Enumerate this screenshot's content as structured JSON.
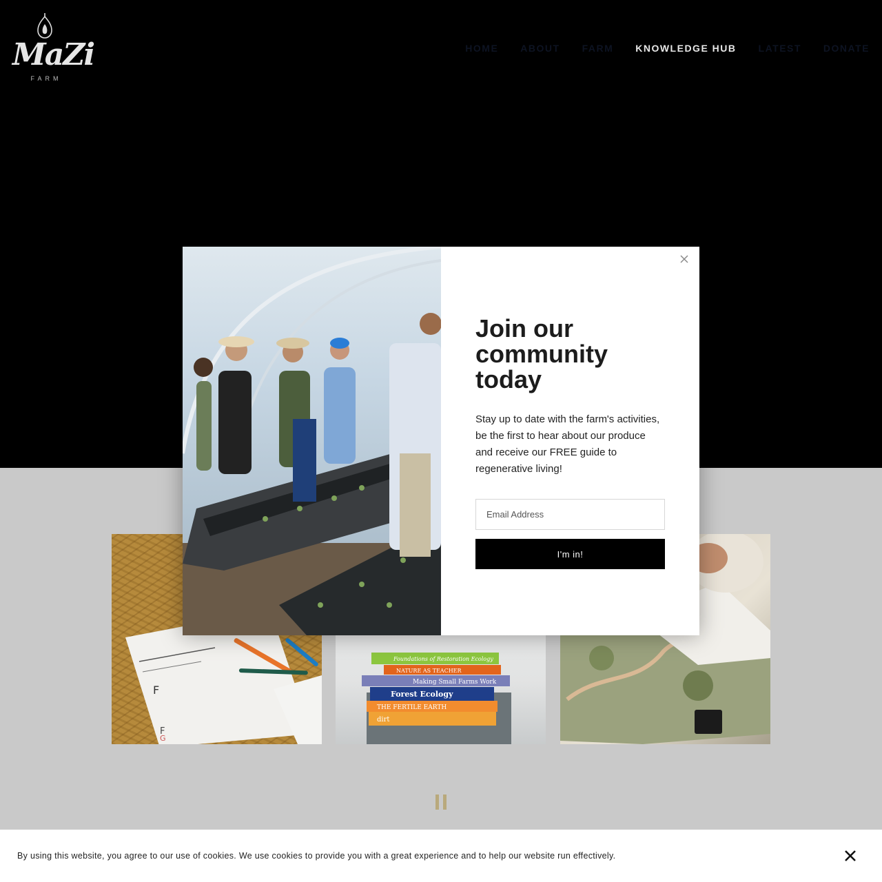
{
  "header": {
    "logo": {
      "word": "MaZi",
      "sub": "FARM",
      "icon": "fig-icon"
    },
    "nav": [
      {
        "label": "HOME",
        "active": false
      },
      {
        "label": "ABOUT",
        "active": false
      },
      {
        "label": "FARM",
        "active": false
      },
      {
        "label": "KNOWLEDGE HUB",
        "active": true
      },
      {
        "label": "LATEST",
        "active": false
      },
      {
        "label": "DONATE",
        "active": false
      }
    ]
  },
  "modal": {
    "close_icon": "close-icon",
    "title": "Join our community today",
    "text": "Stay up to date with the farm's activities, be the first to hear about our produce and receive our FREE guide to regenerative living!",
    "email_placeholder": "Email Address",
    "submit_label": "I'm in!"
  },
  "cards": [
    {
      "name": "planning-notes-photo"
    },
    {
      "name": "book-stack-photo",
      "books": [
        "Foundations of Restoration Ecology",
        "NATURE AS TEACHER",
        "Making Small Farms Work",
        "Forest Ecology",
        "THE FERTILE EARTH",
        "dirt"
      ]
    },
    {
      "name": "map-planning-photo"
    }
  ],
  "slider": {
    "control_icon": "pause-icon"
  },
  "cookie_bar": {
    "text": "By using this website, you agree to our use of cookies. We use cookies to provide you with a great experience and to help our website run effectively.",
    "close_icon": "close-icon"
  },
  "colors": {
    "hero_bg": "#000000",
    "nav_inactive": "#0d1322",
    "nav_active": "#e8e8e8",
    "section_bg": "#c9c9c9",
    "button_bg": "#000000"
  }
}
